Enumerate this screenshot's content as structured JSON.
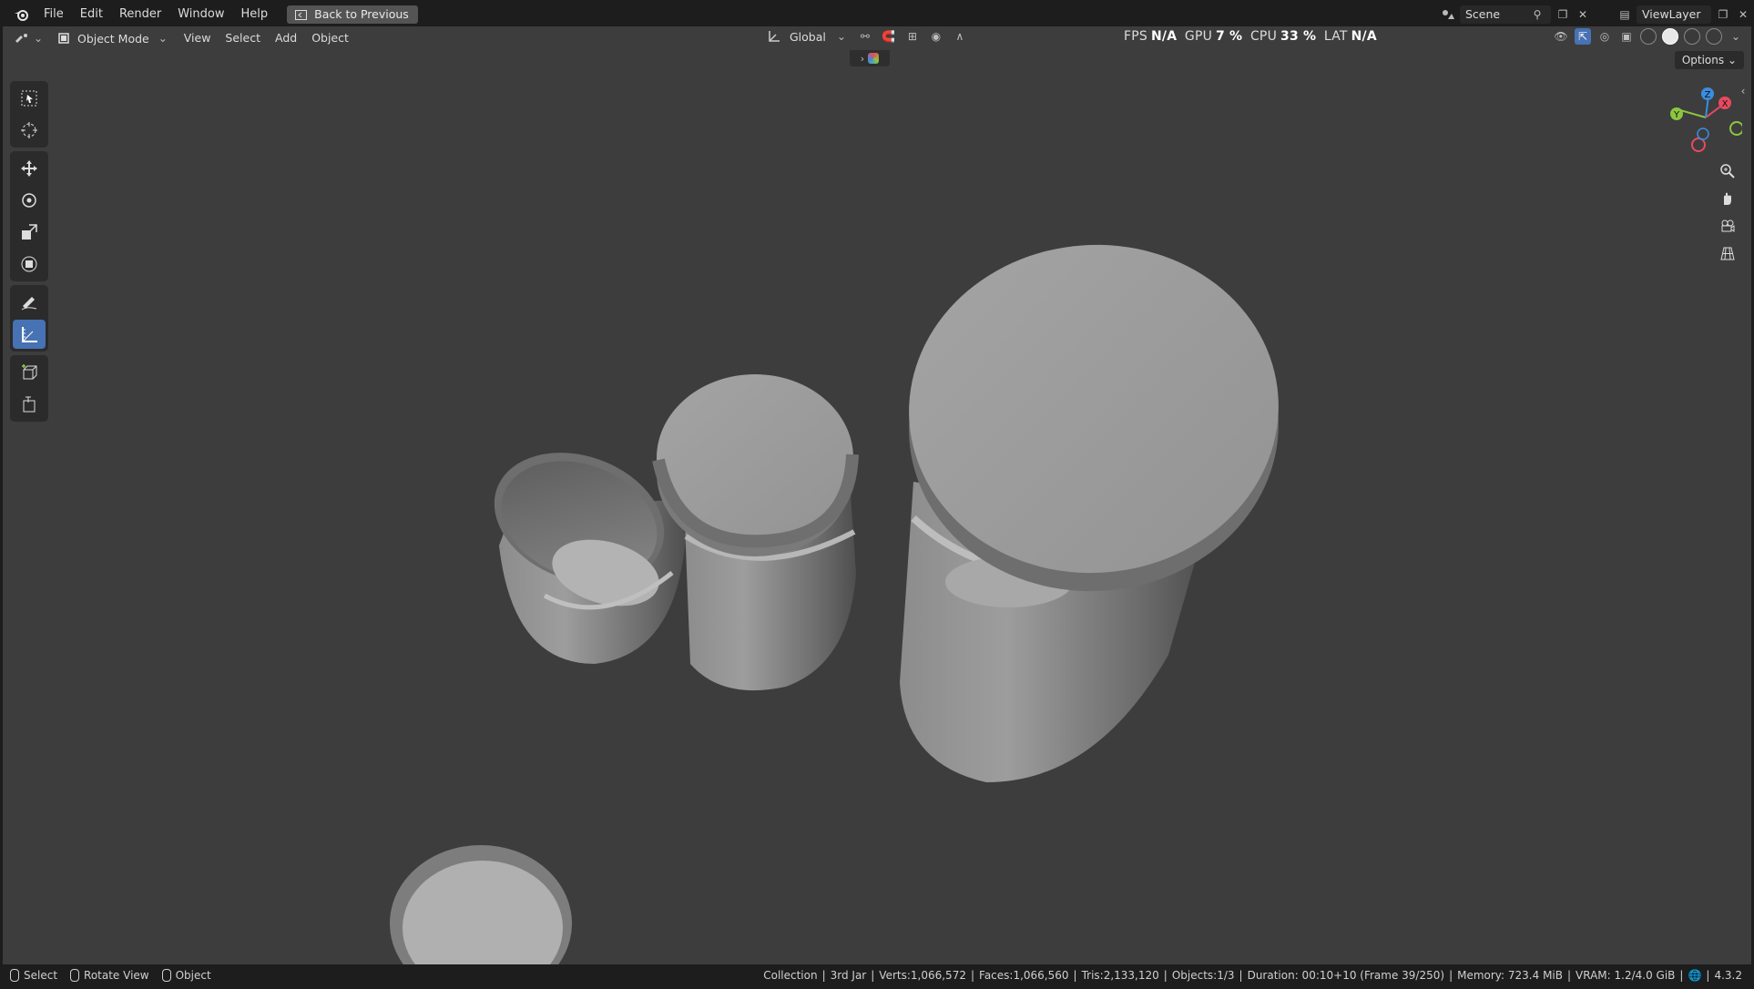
{
  "menu": {
    "items": [
      "File",
      "Edit",
      "Render",
      "Window",
      "Help"
    ],
    "back_button": "Back to Previous"
  },
  "scene": {
    "label": "Scene"
  },
  "view_layer": {
    "label": "ViewLayer"
  },
  "header": {
    "mode": "Object Mode",
    "menus": [
      "View",
      "Select",
      "Add",
      "Object"
    ],
    "transform_orientation": "Global",
    "options_label": "Options"
  },
  "stats": {
    "fps_label": "FPS",
    "fps_value": "N/A",
    "gpu_label": "GPU",
    "gpu_value": "7 %",
    "cpu_label": "CPU",
    "cpu_value": "33 %",
    "lat_label": "LAT",
    "lat_value": "N/A"
  },
  "gizmo": {
    "x": "X",
    "y": "Y",
    "z": "Z"
  },
  "status": {
    "left": [
      {
        "label": "Select"
      },
      {
        "label": "Rotate View"
      },
      {
        "label": "Object"
      }
    ],
    "collection": "Collection",
    "active_object": "3rd Jar",
    "verts": "Verts:1,066,572",
    "faces": "Faces:1,066,560",
    "tris": "Tris:2,133,120",
    "objects": "Objects:1/3",
    "duration": "Duration: 00:10+10 (Frame 39/250)",
    "memory": "Memory: 723.4 MiB",
    "vram": "VRAM: 1.2/4.0 GiB",
    "version": "4.3.2"
  },
  "colors": {
    "viewport_bg": "#3d3d3d",
    "active_tool": "#4772b3",
    "axis_x": "#e84a5f",
    "axis_y": "#8cc63f",
    "axis_z": "#3b8de0"
  }
}
